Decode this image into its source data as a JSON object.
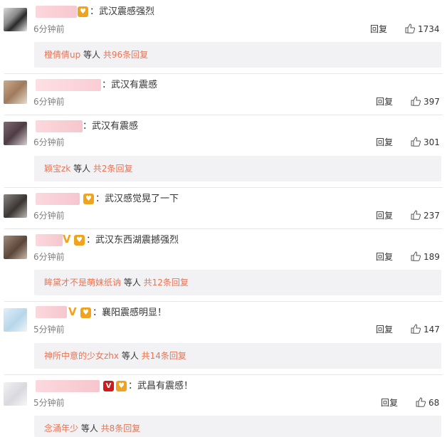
{
  "colors": {
    "link": "#eb7350",
    "time": "#808080",
    "sub_bg": "#f2f2f5"
  },
  "comments": [
    {
      "text": "：武汉震感强烈",
      "time": "6分钟前",
      "reply": "回复",
      "likes": "1734",
      "sub": {
        "user": "橙倩倩up",
        "mid": " 等人 ",
        "count": "共96条回复"
      }
    },
    {
      "text": "：武汉有震感",
      "time": "6分钟前",
      "reply": "回复",
      "likes": "397"
    },
    {
      "text": "：武汉有震感",
      "time": "6分钟前",
      "reply": "回复",
      "likes": "301",
      "sub": {
        "user": "颖宝zk",
        "mid": " 等人 ",
        "count": "共2条回复"
      }
    },
    {
      "text": "：武汉感觉晃了一下",
      "time": "6分钟前",
      "reply": "回复",
      "likes": "237"
    },
    {
      "text": "：武汉东西湖震撼强烈",
      "time": "6分钟前",
      "reply": "回复",
      "likes": "189",
      "sub": {
        "user": "眸黛才不是萌妹纸讷",
        "mid": " 等人 ",
        "count": "共12条回复"
      }
    },
    {
      "text": "：襄阳震感明显！",
      "time": "5分钟前",
      "reply": "回复",
      "likes": "147",
      "sub": {
        "user": "神所中意的少女zhx",
        "mid": " 等人 ",
        "count": "共14条回复"
      }
    },
    {
      "text": "：武昌有震感！",
      "time": "5分钟前",
      "reply": "回复",
      "likes": "68",
      "sub": {
        "user": "念涌年少",
        "mid": " 等人 ",
        "count": "共8条回复"
      }
    }
  ],
  "icons": {
    "like": "thumb-up-icon",
    "member": "heart-badge-icon",
    "verified": "v-badge-icon"
  }
}
